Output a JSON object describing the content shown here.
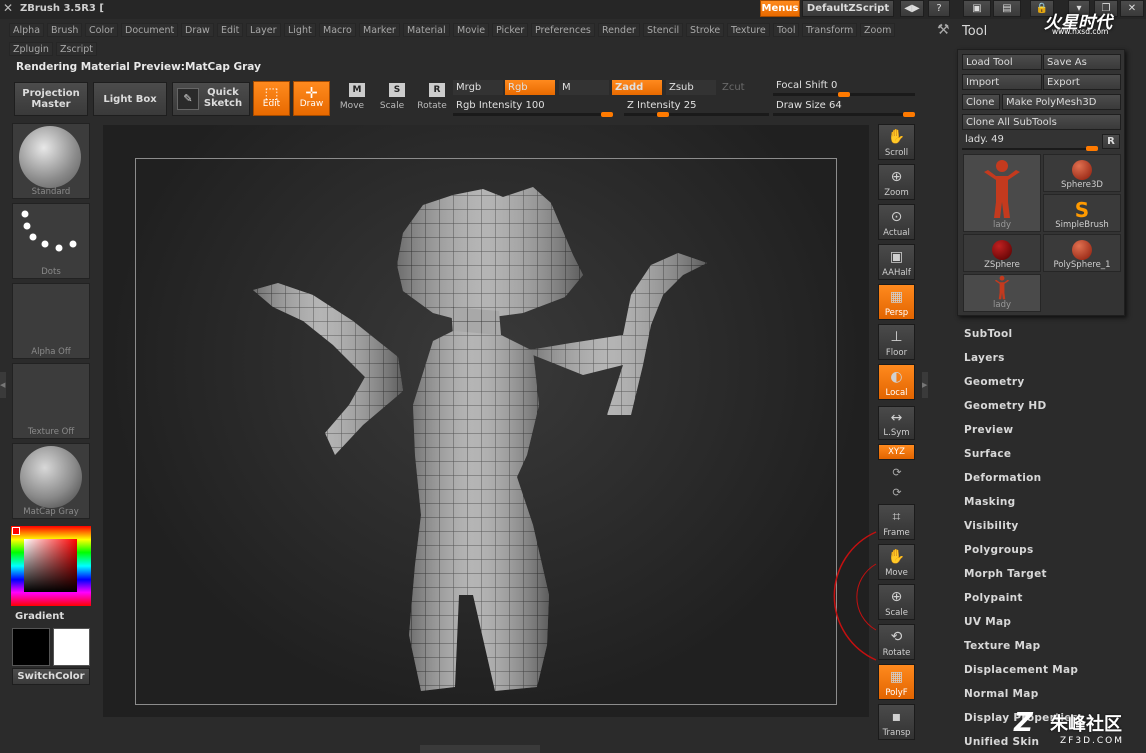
{
  "app": {
    "title": "ZBrush 3.5R3 [",
    "menus_button": "Menus",
    "script_button": "DefaultZScript"
  },
  "menubar": {
    "row1": [
      "Alpha",
      "Brush",
      "Color",
      "Document",
      "Draw",
      "Edit",
      "Layer",
      "Light",
      "Macro",
      "Marker",
      "Material",
      "Movie",
      "Picker",
      "Preferences",
      "Render",
      "Stencil",
      "Stroke",
      "Texture",
      "Tool",
      "Transform",
      "Zoom"
    ],
    "row2": [
      "Zplugin",
      "Zscript"
    ]
  },
  "status": {
    "text": "Rendering Material Preview:MatCap Gray"
  },
  "toolbar": {
    "projection_master": "Projection Master",
    "light_box": "Light Box",
    "quick_sketch": "Quick Sketch",
    "edit": "Edit",
    "draw": "Draw",
    "move": "Move",
    "scale": "Scale",
    "rotate": "Rotate",
    "mrgb": "Mrgb",
    "rgb": "Rgb",
    "m": "M",
    "zadd": "Zadd",
    "zsub": "Zsub",
    "zcut": "Zcut",
    "rgb_intensity": "Rgb Intensity 100",
    "z_intensity": "Z Intensity 25",
    "focal_shift": "Focal Shift 0",
    "draw_size": "Draw Size 64",
    "rgb_intensity_value": 100,
    "z_intensity_value": 25,
    "focal_shift_value": 0,
    "draw_size_value": 64
  },
  "left_tray": {
    "brush": "Standard",
    "stroke": "Dots",
    "alpha": "Alpha Off",
    "texture": "Texture Off",
    "material": "MatCap Gray",
    "gradient": "Gradient",
    "switch_color": "SwitchColor"
  },
  "right_shelf": [
    {
      "label": "Scroll",
      "icon": "scroll-icon",
      "glyph": "✋",
      "active": false
    },
    {
      "label": "Zoom",
      "icon": "zoom-icon",
      "glyph": "⊕",
      "active": false
    },
    {
      "label": "Actual",
      "icon": "actual-icon",
      "glyph": "⊙",
      "active": false
    },
    {
      "label": "AAHalf",
      "icon": "aahalf-icon",
      "glyph": "▣",
      "active": false
    },
    {
      "label": "Persp",
      "icon": "persp-icon",
      "glyph": "▦",
      "active": true
    },
    {
      "label": "Floor",
      "icon": "floor-icon",
      "glyph": "⊥",
      "active": false
    },
    {
      "label": "Local",
      "icon": "local-icon",
      "glyph": "◐",
      "active": true
    },
    {
      "label": "L.Sym",
      "icon": "lsym-icon",
      "glyph": "↔",
      "active": false
    },
    {
      "label": "XYZ",
      "icon": "xyz-icon",
      "glyph": "⟳",
      "active": true
    },
    {
      "label": "Frame",
      "icon": "frame-icon",
      "glyph": "⌗",
      "active": false
    },
    {
      "label": "Move",
      "icon": "move-icon",
      "glyph": "✋",
      "active": false
    },
    {
      "label": "Scale",
      "icon": "scale-icon",
      "glyph": "⊕",
      "active": false
    },
    {
      "label": "Rotate",
      "icon": "rotate-icon",
      "glyph": "⟲",
      "active": false
    },
    {
      "label": "PolyF",
      "icon": "polyf-icon",
      "glyph": "▦",
      "active": true
    },
    {
      "label": "Transp",
      "icon": "transp-icon",
      "glyph": "▪",
      "active": false
    }
  ],
  "tool_panel": {
    "title": "Tool",
    "load_tool": "Load Tool",
    "save_as": "Save As",
    "import": "Import",
    "export": "Export",
    "clone": "Clone",
    "make_polymesh": "Make PolyMesh3D",
    "clone_all_subtools": "Clone All SubTools",
    "current_tool": "lady. 49",
    "r_button": "R",
    "tools": [
      "lady",
      "Sphere3D",
      "SimpleBrush",
      "ZSphere",
      "PolySphere_1",
      "lady"
    ],
    "sections": [
      "SubTool",
      "Layers",
      "Geometry",
      "Geometry HD",
      "Preview",
      "Surface",
      "Deformation",
      "Masking",
      "Visibility",
      "Polygroups",
      "Morph Target",
      "Polypaint",
      "UV Map",
      "Texture Map",
      "Displacement Map",
      "Normal Map",
      "Display Properties",
      "Unified Skin"
    ]
  },
  "watermarks": {
    "top": "火星时代",
    "top_url": "www.hxsd.com",
    "bottom": "朱峰社区",
    "bottom_url": "ZF3D.COM"
  },
  "colors": {
    "accent": "#ff7a00",
    "bg": "#2b2b2b",
    "canvas": "#1c1c1c"
  }
}
